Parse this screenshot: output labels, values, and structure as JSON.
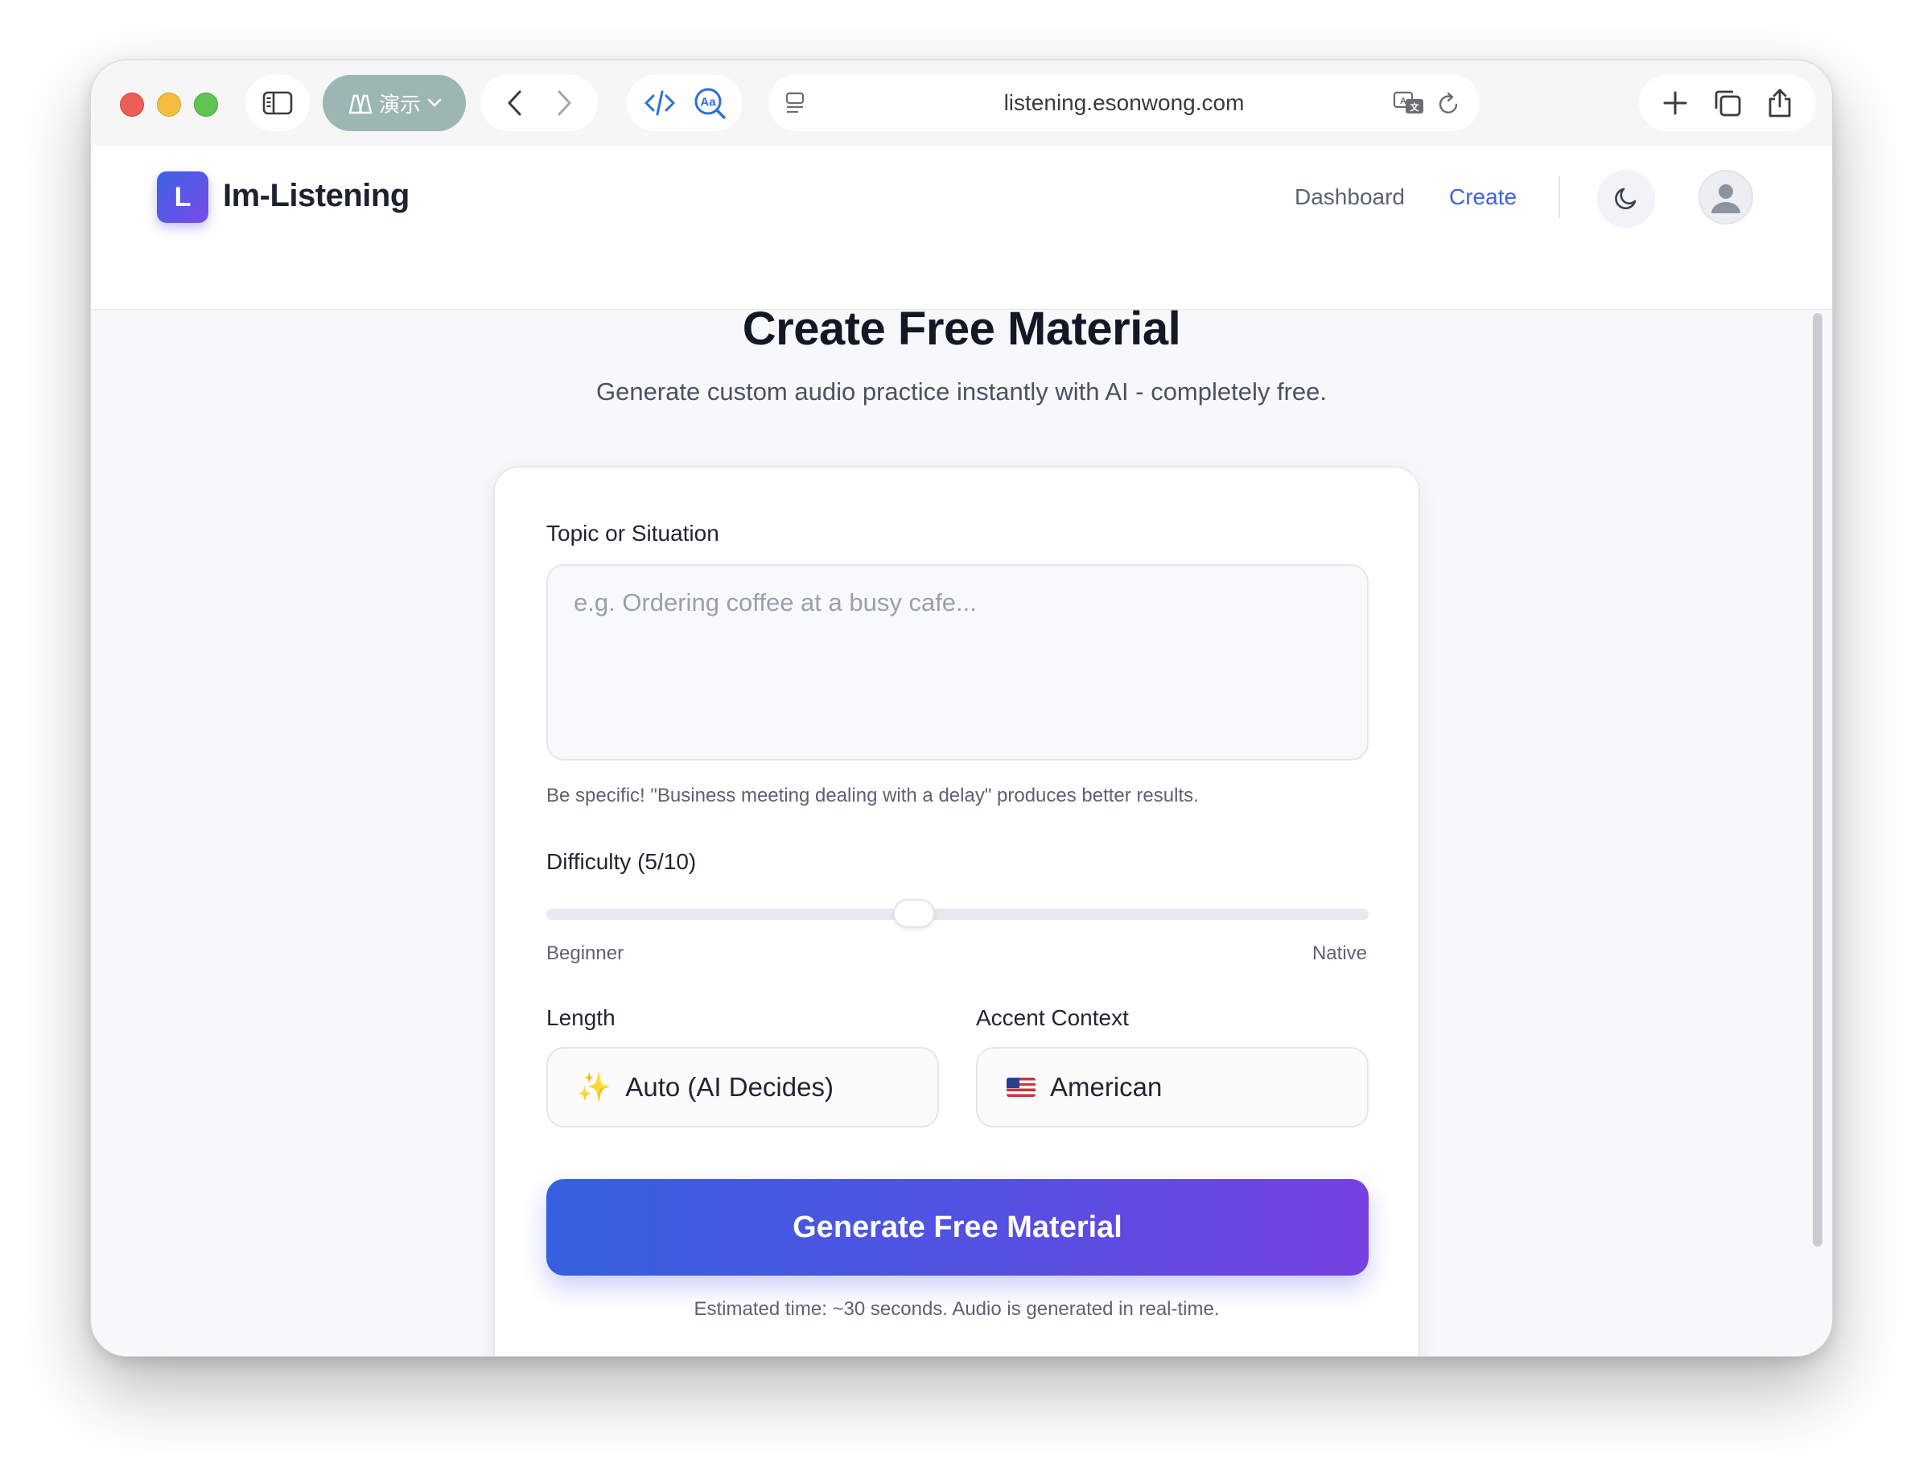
{
  "browser": {
    "profile_label": "演示",
    "url": "listening.esonwong.com"
  },
  "header": {
    "logo_letter": "L",
    "brand": "Im-Listening",
    "nav": {
      "dashboard": "Dashboard",
      "create": "Create"
    }
  },
  "page": {
    "title": "Create Free Material",
    "subtitle": "Generate custom audio practice instantly with AI - completely free."
  },
  "form": {
    "topic_label": "Topic or Situation",
    "topic_placeholder": "e.g. Ordering coffee at a busy cafe...",
    "topic_hint": "Be specific! \"Business meeting dealing with a delay\" produces better results.",
    "difficulty_label": "Difficulty (5/10)",
    "difficulty_value": 5,
    "difficulty_max": 10,
    "difficulty_min_label": "Beginner",
    "difficulty_max_label": "Native",
    "length_label": "Length",
    "length_icon": "✨",
    "length_value": "Auto (AI Decides)",
    "accent_label": "Accent Context",
    "accent_value": "American",
    "generate_button": "Generate Free Material",
    "estimate_text": "Estimated time: ~30 seconds. Audio is generated in real-time."
  },
  "colors": {
    "accent": "#3d63e4",
    "button_gradient_start": "#3560e0",
    "button_gradient_end": "#7641e2"
  }
}
